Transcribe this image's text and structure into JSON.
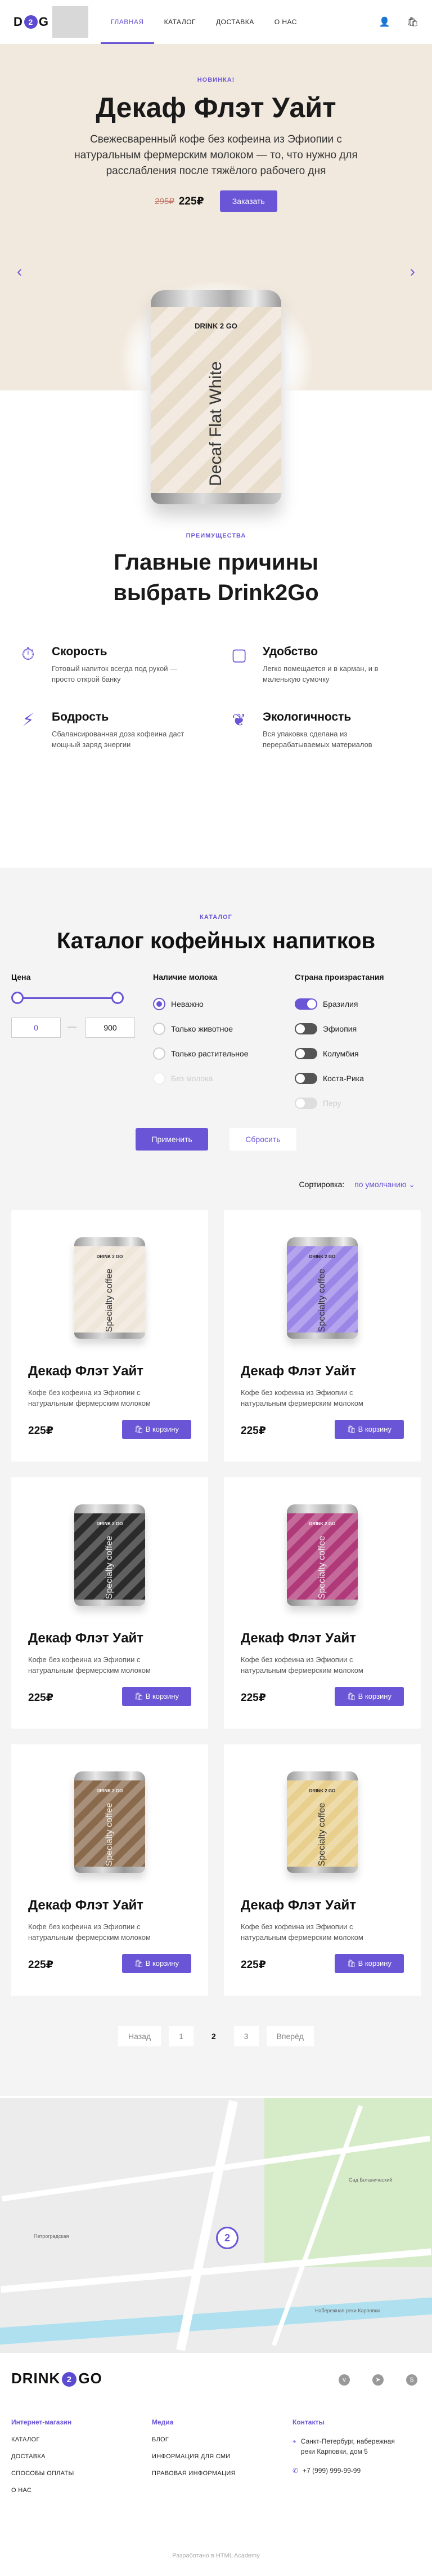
{
  "header": {
    "logo": {
      "left": "D",
      "two": "2",
      "right": "G"
    },
    "nav": [
      "ГЛАВНАЯ",
      "КАТАЛОГ",
      "ДОСТАВКА",
      "О НАС"
    ],
    "icons": [
      "user-icon",
      "basket-icon"
    ]
  },
  "hero": {
    "kicker": "НОВИНКА!",
    "title": "Декаф Флэт Уайт",
    "subtitle": "Свежесваренный кофе без кофеина из Эфиопии с натуральным фермерским молоком — то, что нужно для расслабления после тяжёлого рабочего дня",
    "old_price": "295₽",
    "price": "225₽",
    "order_label": "Заказать",
    "can_brand": "DRINK 2 GO",
    "can_text": "Decaf Flat White"
  },
  "reasons": {
    "kicker": "ПРЕИМУЩЕСТВА",
    "title": "Главные причины выбрать Drink2Go",
    "items": [
      {
        "title": "Скорость",
        "text": "Готовый напиток всегда под рукой — просто открой банку"
      },
      {
        "title": "Удобство",
        "text": "Легко помещается и в карман, и в маленькую сумочку"
      },
      {
        "title": "Бодрость",
        "text": "Сбалансированная доза кофеина даст мощный заряд энергии"
      },
      {
        "title": "Экологичность",
        "text": "Вся упаковка сделана из перерабатываемых материалов"
      }
    ]
  },
  "catalog": {
    "kicker": "КАТАЛОГ",
    "title": "Каталог кофейных напитков",
    "price_title": "Цена",
    "price_min": "0",
    "price_max": "900",
    "milk_title": "Наличие молока",
    "milk_options": [
      "Неважно",
      "Только животное",
      "Только растительное",
      "Без молока"
    ],
    "country_title": "Страна произрастания",
    "countries": [
      "Бразилия",
      "Эфиопия",
      "Колумбия",
      "Коста-Рика",
      "Перу"
    ],
    "apply_label": "Применить",
    "reset_label": "Сбросить",
    "sort_label": "Сортировка:",
    "sort_value": "по умолчанию",
    "products": [
      {
        "name": "Декаф Флэт Уайт",
        "desc": "Кофе без кофеина из Эфиопии с натуральным фермерским молоком",
        "price": "225₽",
        "cart": "В корзину",
        "can_text": "Specialty coffee",
        "color": "#efe6da"
      },
      {
        "name": "Декаф Флэт Уайт",
        "desc": "Кофе без кофеина из Эфиопии с натуральным фермерским молоком",
        "price": "225₽",
        "cart": "В корзину",
        "can_text": "Specialty coffee",
        "color": "#9b86e8"
      },
      {
        "name": "Декаф Флэт Уайт",
        "desc": "Кофе без кофеина из Эфиопии с натуральным фермерским молоком",
        "price": "225₽",
        "cart": "В корзину",
        "can_text": "Specialty coffee",
        "color": "#2b2b2b"
      },
      {
        "name": "Декаф Флэт Уайт",
        "desc": "Кофе без кофеина из Эфиопии с натуральным фермерским молоком",
        "price": "225₽",
        "cart": "В корзину",
        "can_text": "Specialty coffee",
        "color": "#b0397a"
      },
      {
        "name": "Декаф Флэт Уайт",
        "desc": "Кофе без кофеина из Эфиопии с натуральным фермерским молоком",
        "price": "225₽",
        "cart": "В корзину",
        "can_text": "Specialty coffee",
        "color": "#8a6a4c"
      },
      {
        "name": "Декаф Флэт Уайт",
        "desc": "Кофе без кофеина из Эфиопии с натуральным фермерским молоком",
        "price": "225₽",
        "cart": "В корзину",
        "can_text": "Specialty coffee",
        "color": "#e8cf8e"
      }
    ],
    "pager": [
      "Назад",
      "1",
      "2",
      "3",
      "Вперёд"
    ]
  },
  "map": {
    "labels": [
      "Набережная реки Карповки",
      "Сад Ботанический",
      "Петроградская"
    ],
    "pin": "2"
  },
  "footer": {
    "logo_left": "DRINK",
    "logo_two": "2",
    "logo_right": "GO",
    "col1_title": "Интернет-магазин",
    "col1_links": [
      "КАТАЛОГ",
      "ДОСТАВКА",
      "СПОСОБЫ ОПЛАТЫ",
      "О НАС"
    ],
    "col2_title": "Медиа",
    "col2_links": [
      "БЛОГ",
      "ИНФОРМАЦИЯ ДЛЯ СМИ",
      "ПРАВОВАЯ ИНФОРМАЦИЯ"
    ],
    "col3_title": "Контакты",
    "address": "Санкт-Петербург, набережная реки Карповки, дом 5",
    "phone": "+7 (999) 999-99-99",
    "copyright": "Разработано в HTML Academy",
    "socials": [
      "vk-icon",
      "telegram-icon",
      "skype-icon"
    ]
  },
  "colors": {
    "accent": "#6a55d6",
    "hero_bg": "#f1e9de",
    "catalog_bg": "#f4f4f4"
  }
}
